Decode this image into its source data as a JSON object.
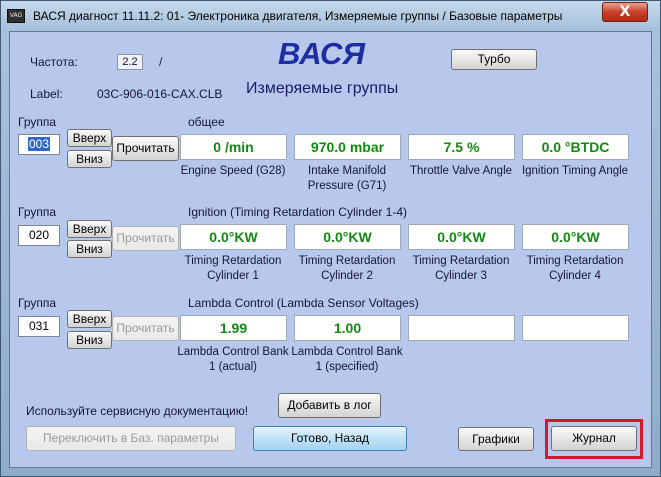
{
  "window": {
    "title": "ВАСЯ диагност 11.11.2: 01- Электроника двигателя,  Измеряемые группы / Базовые параметры",
    "app_icon_text": "VAG",
    "close_label": "X"
  },
  "header": {
    "freq_label": "Частота:",
    "freq_value": "2.2",
    "freq_slash": "/",
    "label_label": "Label:",
    "label_value": "03C-906-016-CAX.CLB",
    "app_name": "ВАСЯ",
    "subtitle": "Измеряемые группы",
    "turbo_label": "Турбо"
  },
  "groups": [
    {
      "group_label": "Группа",
      "number": "003",
      "up_label": "Вверх",
      "down_label": "Вниз",
      "read_label": "Прочитать",
      "title": "общее",
      "values": [
        "0 /min",
        "970.0 mbar",
        "7.5 %",
        "0.0 °BTDC"
      ],
      "captions": [
        "Engine Speed (G28)",
        "Intake Manifold Pressure (G71)",
        "Throttle Valve Angle",
        "Ignition Timing Angle"
      ]
    },
    {
      "group_label": "Группа",
      "number": "020",
      "up_label": "Вверх",
      "down_label": "Вниз",
      "read_label": "Прочитать",
      "title": "Ignition (Timing Retardation Cylinder 1-4)",
      "values": [
        "0.0°KW",
        "0.0°KW",
        "0.0°KW",
        "0.0°KW"
      ],
      "captions": [
        "Timing Retardation Cylinder 1",
        "Timing Retardation Cylinder 2",
        "Timing Retardation Cylinder 3",
        "Timing Retardation Cylinder 4"
      ]
    },
    {
      "group_label": "Группа",
      "number": "031",
      "up_label": "Вверх",
      "down_label": "Вниз",
      "read_label": "Прочитать",
      "title": "Lambda Control (Lambda Sensor Voltages)",
      "values": [
        "1.99",
        "1.00",
        "",
        ""
      ],
      "captions": [
        "Lambda Control Bank 1 (actual)",
        "Lambda Control Bank 1 (specified)",
        "",
        ""
      ]
    }
  ],
  "footer": {
    "notice": "Используйте сервисную документацию!",
    "add_log_label": "Добавить в лог",
    "switch_basic_label": "Переключить в Баз. параметры",
    "done_back_label": "Готово, Назад",
    "graphs_label": "Графики",
    "journal_label": "Журнал"
  },
  "colors": {
    "value_text": "#128a12",
    "title_blue": "#1e2ea0",
    "highlight_frame": "#d6182e"
  }
}
